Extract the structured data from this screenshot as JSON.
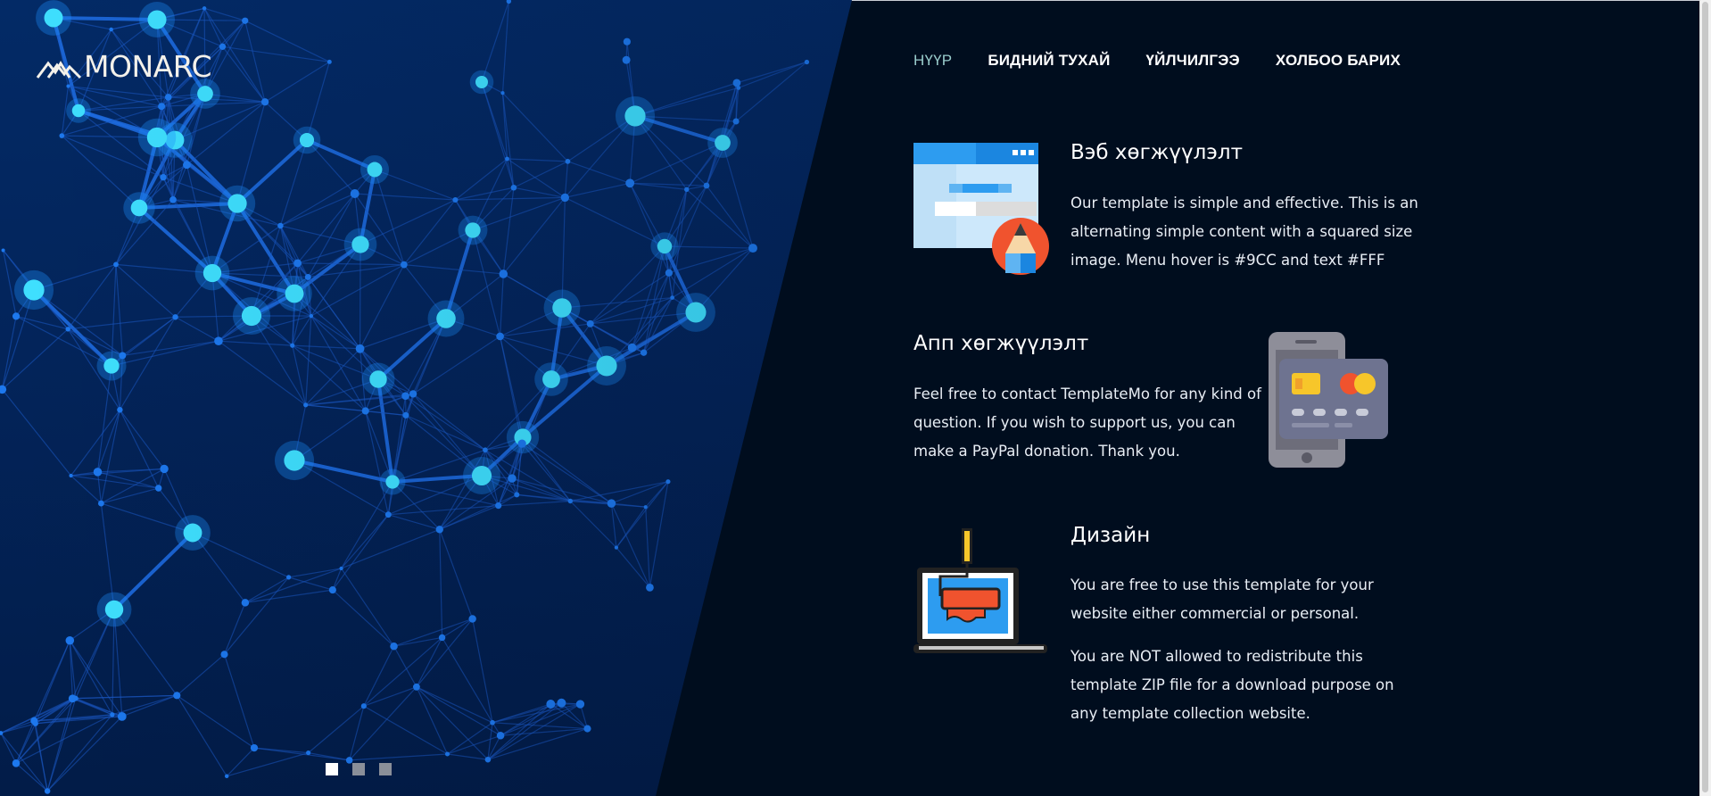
{
  "logo": {
    "text": "MONARC"
  },
  "nav": {
    "items": [
      {
        "label": "НҮҮР",
        "active": true
      },
      {
        "label": "БИДНИЙ ТУХАЙ",
        "active": false
      },
      {
        "label": "ҮЙЛЧИЛГЭЭ",
        "active": false
      },
      {
        "label": "ХОЛБОО БАРИХ",
        "active": false
      }
    ]
  },
  "sections": [
    {
      "title": "Вэб хөгжүүлэлт",
      "icon": "web-design-icon",
      "paragraphs": [
        "Our template is simple and effective. This is an",
        "alternating simple content with a squared size",
        "image. Menu hover is #9CC and text #FFF"
      ]
    },
    {
      "title": "Апп хөгжүүлэлт",
      "icon": "mobile-payment-icon",
      "paragraphs": [
        "Feel free to contact TemplateMo for any kind of",
        "question. If you wish to support us, you can",
        "make a PayPal donation. Thank you."
      ]
    },
    {
      "title": "Дизайн",
      "icon": "laptop-paint-roller-icon",
      "paragraphs": [
        "You are free to use this template for your",
        "website either commercial or personal.",
        "You are NOT allowed to redistribute this",
        "template ZIP file for a download purpose on",
        "any template collection website."
      ]
    }
  ],
  "slider": {
    "total_slides": 3,
    "active_index": 0
  },
  "colors": {
    "background": "#000d1e",
    "hero": "#03245a",
    "nav_active": "#99cccc",
    "text": "#ffffff"
  }
}
